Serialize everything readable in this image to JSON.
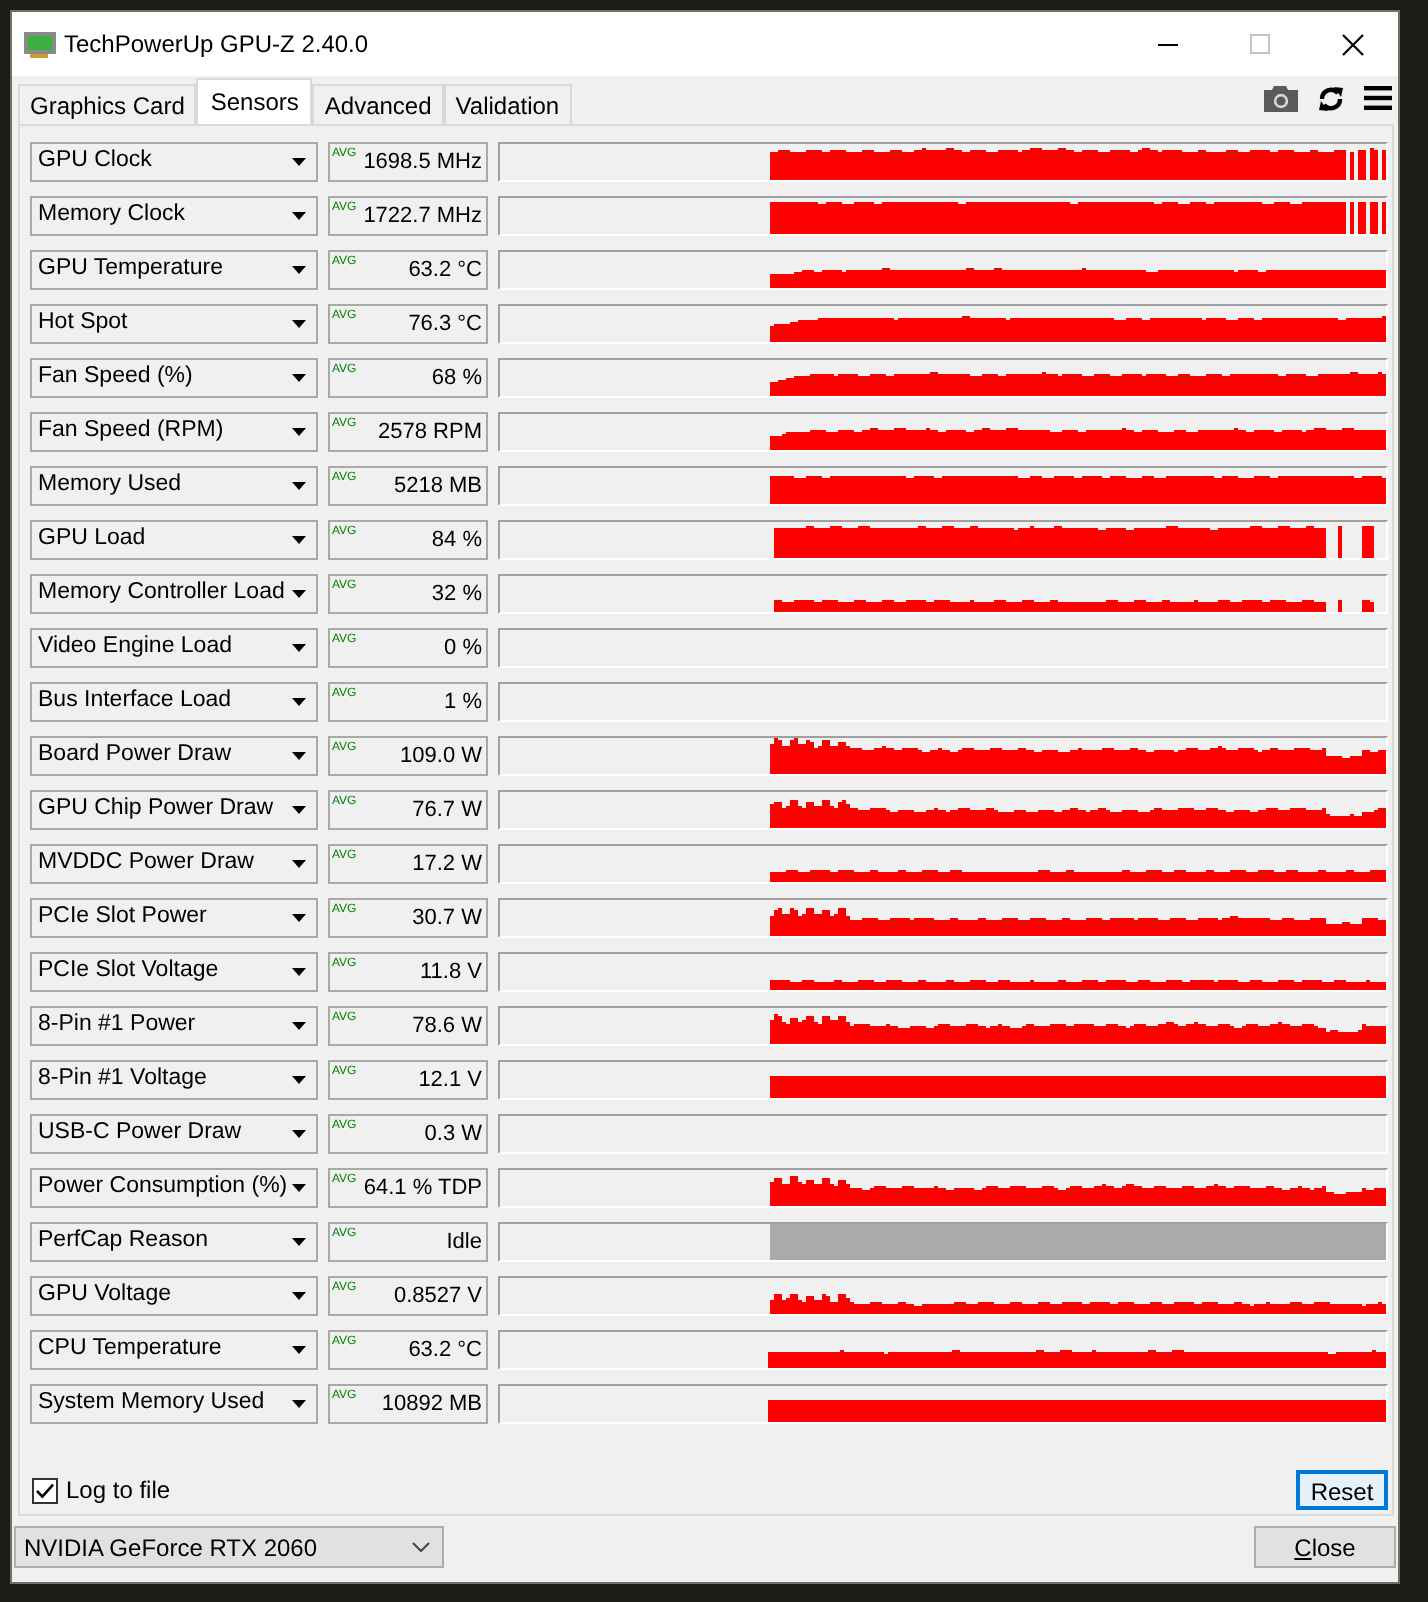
{
  "window": {
    "title": "TechPowerUp GPU-Z 2.40.0",
    "maximize_disabled": true
  },
  "tabs": [
    {
      "label": "Graphics Card",
      "selected": false
    },
    {
      "label": "Sensors",
      "selected": true
    },
    {
      "label": "Advanced",
      "selected": false
    },
    {
      "label": "Validation",
      "selected": false
    }
  ],
  "sensors": [
    {
      "name": "GPU Clock",
      "tag": "AVG",
      "value": "1698.5 MHz"
    },
    {
      "name": "Memory Clock",
      "tag": "AVG",
      "value": "1722.7 MHz"
    },
    {
      "name": "GPU Temperature",
      "tag": "AVG",
      "value": "63.2 °C"
    },
    {
      "name": "Hot Spot",
      "tag": "AVG",
      "value": "76.3 °C"
    },
    {
      "name": "Fan Speed (%)",
      "tag": "AVG",
      "value": "68 %"
    },
    {
      "name": "Fan Speed (RPM)",
      "tag": "AVG",
      "value": "2578 RPM"
    },
    {
      "name": "Memory Used",
      "tag": "AVG",
      "value": "5218 MB"
    },
    {
      "name": "GPU Load",
      "tag": "AVG",
      "value": "84 %"
    },
    {
      "name": "Memory Controller Load",
      "tag": "AVG",
      "value": "32 %"
    },
    {
      "name": "Video Engine Load",
      "tag": "AVG",
      "value": "0 %"
    },
    {
      "name": "Bus Interface Load",
      "tag": "AVG",
      "value": "1 %"
    },
    {
      "name": "Board Power Draw",
      "tag": "AVG",
      "value": "109.0 W"
    },
    {
      "name": "GPU Chip Power Draw",
      "tag": "AVG",
      "value": "76.7 W"
    },
    {
      "name": "MVDDC Power Draw",
      "tag": "AVG",
      "value": "17.2 W"
    },
    {
      "name": "PCIe Slot Power",
      "tag": "AVG",
      "value": "30.7 W"
    },
    {
      "name": "PCIe Slot Voltage",
      "tag": "AVG",
      "value": "11.8 V"
    },
    {
      "name": "8-Pin #1 Power",
      "tag": "AVG",
      "value": "78.6 W"
    },
    {
      "name": "8-Pin #1 Voltage",
      "tag": "AVG",
      "value": "12.1 V"
    },
    {
      "name": "USB-C Power Draw",
      "tag": "AVG",
      "value": "0.3 W"
    },
    {
      "name": "Power Consumption (%)",
      "tag": "AVG",
      "value": "64.1 % TDP"
    },
    {
      "name": "PerfCap Reason",
      "tag": "AVG",
      "value": "Idle"
    },
    {
      "name": "GPU Voltage",
      "tag": "AVG",
      "value": "0.8527 V"
    },
    {
      "name": "CPU Temperature",
      "tag": "AVG",
      "value": "63.2 °C"
    },
    {
      "name": "System Memory Used",
      "tag": "AVG",
      "value": "10892 MB"
    }
  ],
  "log_to_file": {
    "label": "Log to file",
    "checked": true
  },
  "reset_button": {
    "label": "Reset",
    "focused": true
  },
  "gpu_select": {
    "value": "NVIDIA GeForce RTX 2060"
  },
  "close_button": {
    "label": "Close"
  }
}
